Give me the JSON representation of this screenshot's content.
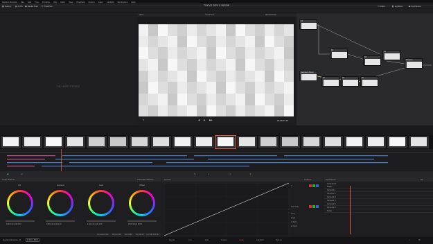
{
  "app": {
    "title": "TOKYO 2020 X VIRGIN",
    "menu": [
      "DaVinci Resolve",
      "File",
      "Edit",
      "Trim",
      "Timeline",
      "Clip",
      "Mark",
      "View",
      "Playback",
      "Fusion",
      "Color",
      "Fairlight",
      "Workspace",
      "Help"
    ],
    "toolbar_left": [
      "Gallery",
      "LUTs",
      "Media Pool",
      "Timelines",
      "Clips",
      "Nodes",
      "OpenFX",
      "Lightbox"
    ],
    "toolbar_right": [
      "Clips",
      "Lightbox",
      "Keyframes"
    ]
  },
  "gallery": {
    "empty_message": "No stills created"
  },
  "viewer": {
    "zoom": "39%",
    "timeline_name": "Timeline 1",
    "timecode_top": "00:00:00:00",
    "timecode_bottom": "01:00:27:10"
  },
  "nodes": {
    "labels": [
      "01",
      "02",
      "03",
      "04",
      "05",
      "06",
      "07",
      "08",
      "09"
    ],
    "titles": [
      "Sharpen",
      "Saturation Boost",
      "Denoise",
      "Contrast",
      "Grain"
    ]
  },
  "clips": {
    "count": 20
  },
  "color_wheels": {
    "title": "Color Wheels",
    "mode": "Primaries Wheels",
    "wheels": [
      {
        "name": "Lift",
        "values": "0.00 0.00 0.00 0.00"
      },
      {
        "name": "Gamma",
        "values": "0.00 0.00 0.00 0.00"
      },
      {
        "name": "Gain",
        "values": "1.00 1.00 1.00 1.00"
      },
      {
        "name": "Offset",
        "values": "25.00 25.00 25.00"
      }
    ],
    "footer": [
      "Contrast 1.000",
      "Pivot 0.435",
      "Sat 50.00",
      "Hue 50.00",
      "Lum Mix 100.00"
    ]
  },
  "curves": {
    "title": "Curves",
    "panel": "Custom",
    "channels": [
      "Y",
      "R",
      "G",
      "B"
    ],
    "soft_clip_label": "Soft Clip",
    "params": [
      "Low",
      "High",
      "L.Soft",
      "H.Soft"
    ]
  },
  "keyframes": {
    "title": "Keyframes",
    "filter": "All",
    "timecode": "00:00:00:00",
    "rows": [
      "Master",
      "Corrector 1",
      "Corrector 2",
      "Corrector 3",
      "Corrector 4",
      "Corrector 5",
      "Corrector 6",
      "Sizing"
    ]
  },
  "pages": [
    "Media",
    "Cut",
    "Edit",
    "Fusion",
    "Color",
    "Fairlight",
    "Deliver"
  ],
  "status": {
    "app_version": "DaVinci Resolve 16",
    "badge": "PUBLIC BETA"
  },
  "accent": "#e05a3c"
}
